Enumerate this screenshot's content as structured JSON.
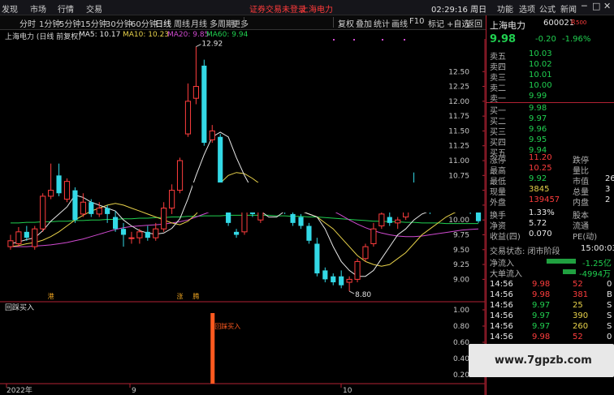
{
  "menubar": {
    "items": [
      "发现",
      "市场",
      "行情",
      "交易"
    ],
    "alert": "证券交易未登录",
    "stock": "上海电力",
    "time": "02:29:16 周日",
    "right_items": [
      "功能",
      "选项",
      "公式",
      "新闻"
    ],
    "window_controls": [
      "minimize-icon",
      "maximize-icon",
      "close-icon"
    ]
  },
  "toolbar": {
    "periods": [
      "分时",
      "1分钟",
      "5分钟",
      "15分钟",
      "30分钟",
      "60分钟",
      "日线",
      "周线",
      "月线",
      "多周期",
      "更多"
    ],
    "tools": [
      "复权",
      "叠加",
      "统计",
      "画线",
      "F10",
      "标记",
      "+自选",
      "返回"
    ]
  },
  "chart_header": {
    "title": "上海电力 (日线 前复权)",
    "ma5": "MA5: 10.17",
    "ma10": "MA10: 10.23",
    "ma20": "MA20: 9.85",
    "ma60": "MA60: 9.94"
  },
  "colors": {
    "up": "#ff3d3d",
    "down": "#33d9e6",
    "ma5": "#e8e8e8",
    "ma10": "#e8d24a",
    "ma20": "#d04ad0",
    "ma60": "#20d050",
    "bg": "#000000"
  },
  "chart_data": {
    "type": "candlestick",
    "y_ticks": [
      "12.50",
      "12.25",
      "12.00",
      "11.75",
      "11.50",
      "11.25",
      "11.00",
      "10.75",
      "10.50",
      "10.25",
      "10.00",
      "9.75",
      "9.50",
      "9.25",
      "9.00"
    ],
    "ylim": [
      8.65,
      13.05
    ],
    "annotations": [
      {
        "text": "12.92",
        "x_index": 23,
        "y": 12.92
      },
      {
        "text": "8.80",
        "x_index": 42,
        "y": 8.8
      }
    ],
    "signal_labels": [
      {
        "text": "港",
        "x_index": 5
      },
      {
        "text": "涨",
        "x_index": 21
      },
      {
        "text": "腾",
        "x_index": 23
      }
    ],
    "x_labels": [
      "2022年",
      "9",
      "10"
    ],
    "candles": [
      {
        "o": 9.55,
        "c": 9.65,
        "h": 9.75,
        "l": 9.5
      },
      {
        "o": 9.6,
        "c": 9.8,
        "h": 9.88,
        "l": 9.55
      },
      {
        "o": 9.8,
        "c": 9.7,
        "h": 9.9,
        "l": 9.65
      },
      {
        "o": 9.55,
        "c": 9.85,
        "h": 9.9,
        "l": 9.5
      },
      {
        "o": 9.85,
        "c": 10.4,
        "h": 10.45,
        "l": 9.8
      },
      {
        "o": 10.4,
        "c": 10.5,
        "h": 10.95,
        "l": 10.35
      },
      {
        "o": 10.75,
        "c": 10.45,
        "h": 10.95,
        "l": 10.4
      },
      {
        "o": 10.35,
        "c": 10.65,
        "h": 10.7,
        "l": 10.3
      },
      {
        "o": 10.5,
        "c": 10.0,
        "h": 10.55,
        "l": 9.95
      },
      {
        "o": 10.1,
        "c": 10.3,
        "h": 10.45,
        "l": 10.05
      },
      {
        "o": 10.3,
        "c": 10.1,
        "h": 10.35,
        "l": 10.05
      },
      {
        "o": 10.1,
        "c": 10.2,
        "h": 10.3,
        "l": 10.05
      },
      {
        "o": 10.2,
        "c": 10.1,
        "h": 10.25,
        "l": 9.95
      },
      {
        "o": 10.05,
        "c": 9.85,
        "h": 10.15,
        "l": 9.8
      },
      {
        "o": 9.85,
        "c": 9.75,
        "h": 9.95,
        "l": 9.55
      },
      {
        "o": 9.7,
        "c": 9.7,
        "h": 9.8,
        "l": 9.6
      },
      {
        "o": 9.7,
        "c": 9.8,
        "h": 9.85,
        "l": 9.6
      },
      {
        "o": 9.8,
        "c": 9.7,
        "h": 9.9,
        "l": 9.65
      },
      {
        "o": 9.7,
        "c": 9.85,
        "h": 9.95,
        "l": 9.65
      },
      {
        "o": 9.85,
        "c": 10.2,
        "h": 10.3,
        "l": 9.8
      },
      {
        "o": 10.2,
        "c": 10.5,
        "h": 10.6,
        "l": 10.1
      },
      {
        "o": 10.5,
        "c": 11.0,
        "h": 11.05,
        "l": 10.45
      },
      {
        "o": 11.45,
        "c": 12.0,
        "h": 12.3,
        "l": 11.4
      },
      {
        "o": 12.05,
        "c": 12.25,
        "h": 12.92,
        "l": 11.95
      },
      {
        "o": 12.6,
        "c": 11.3,
        "h": 12.7,
        "l": 11.25
      },
      {
        "o": 11.35,
        "c": 11.5,
        "h": 11.6,
        "l": 11.3
      },
      {
        "o": 11.4,
        "c": 10.2,
        "h": 11.45,
        "l": 10.15
      },
      {
        "o": 10.3,
        "c": 9.95,
        "h": 10.4,
        "l": 9.9
      },
      {
        "o": 9.8,
        "c": 9.75,
        "h": 9.85,
        "l": 9.7
      },
      {
        "o": 9.8,
        "c": 10.3,
        "h": 10.5,
        "l": 9.75
      },
      {
        "o": 10.4,
        "c": 10.1,
        "h": 10.5,
        "l": 10.05
      },
      {
        "o": 10.0,
        "c": 10.3,
        "h": 10.4,
        "l": 9.95
      },
      {
        "o": 10.3,
        "c": 10.25,
        "h": 10.45,
        "l": 10.2
      },
      {
        "o": 10.2,
        "c": 10.3,
        "h": 10.35,
        "l": 10.15
      },
      {
        "o": 10.3,
        "c": 10.15,
        "h": 10.4,
        "l": 10.1
      },
      {
        "o": 10.1,
        "c": 9.95,
        "h": 10.2,
        "l": 9.9
      },
      {
        "o": 10.05,
        "c": 9.9,
        "h": 10.1,
        "l": 9.85
      },
      {
        "o": 9.9,
        "c": 9.65,
        "h": 9.95,
        "l": 9.6
      },
      {
        "o": 9.6,
        "c": 9.1,
        "h": 9.7,
        "l": 9.05
      },
      {
        "o": 9.15,
        "c": 9.0,
        "h": 9.2,
        "l": 8.95
      },
      {
        "o": 9.05,
        "c": 8.95,
        "h": 9.1,
        "l": 8.9
      },
      {
        "o": 9.05,
        "c": 8.9,
        "h": 9.15,
        "l": 8.85
      },
      {
        "o": 8.95,
        "c": 9.0,
        "h": 9.05,
        "l": 8.8
      },
      {
        "o": 9.0,
        "c": 9.3,
        "h": 9.35,
        "l": 8.95
      },
      {
        "o": 9.35,
        "c": 9.55,
        "h": 9.6,
        "l": 9.3
      },
      {
        "o": 9.6,
        "c": 9.85,
        "h": 9.95,
        "l": 9.55
      },
      {
        "o": 9.9,
        "c": 10.1,
        "h": 10.15,
        "l": 9.85
      },
      {
        "o": 10.05,
        "c": 9.95,
        "h": 10.15,
        "l": 9.9
      },
      {
        "o": 9.95,
        "c": 10.0,
        "h": 10.05,
        "l": 9.85
      },
      {
        "o": 10.05,
        "c": 10.2,
        "h": 10.25,
        "l": 10.0
      },
      {
        "o": 10.4,
        "c": 10.25,
        "h": 10.8,
        "l": 10.2
      },
      {
        "o": 10.25,
        "c": 10.4,
        "h": 10.45,
        "l": 10.2
      },
      {
        "o": 10.45,
        "c": 10.2,
        "h": 10.5,
        "l": 10.1
      },
      {
        "o": 10.3,
        "c": 10.25,
        "h": 10.45,
        "l": 10.2
      },
      {
        "o": 10.25,
        "c": 10.3,
        "h": 10.35,
        "l": 10.2
      },
      {
        "o": 10.35,
        "c": 10.2,
        "h": 10.45,
        "l": 10.15
      },
      {
        "o": 10.2,
        "c": 10.3,
        "h": 10.6,
        "l": 10.15
      },
      {
        "o": 10.3,
        "c": 10.15,
        "h": 10.45,
        "l": 10.1
      },
      {
        "o": 10.15,
        "c": 9.98,
        "h": 10.2,
        "l": 9.95
      }
    ],
    "ma5": [
      9.6,
      9.63,
      9.67,
      9.7,
      9.82,
      9.98,
      10.1,
      10.22,
      10.42,
      10.38,
      10.3,
      10.25,
      10.2,
      10.15,
      10.0,
      9.9,
      9.82,
      9.78,
      9.76,
      9.78,
      9.86,
      10.02,
      10.36,
      10.75,
      11.1,
      11.4,
      11.48,
      11.4,
      11.05,
      10.75,
      10.5,
      10.15,
      10.05,
      10.05,
      10.15,
      10.15,
      10.15,
      10.1,
      10.05,
      9.85,
      9.55,
      9.3,
      9.15,
      9.05,
      9.05,
      9.15,
      9.35,
      9.55,
      9.75,
      9.85,
      10.0,
      10.1,
      10.15,
      10.2,
      10.25,
      10.3,
      10.3,
      10.28,
      10.2
    ],
    "ma10": [
      9.55,
      9.57,
      9.6,
      9.62,
      9.66,
      9.72,
      9.8,
      9.9,
      10.0,
      10.08,
      10.15,
      10.2,
      10.25,
      10.28,
      10.25,
      10.2,
      10.15,
      10.1,
      10.05,
      10.0,
      9.95,
      9.92,
      9.98,
      10.1,
      10.28,
      10.45,
      10.62,
      10.75,
      10.8,
      10.78,
      10.7,
      10.6,
      10.5,
      10.4,
      10.3,
      10.22,
      10.15,
      10.1,
      10.05,
      9.95,
      9.85,
      9.7,
      9.55,
      9.4,
      9.3,
      9.25,
      9.22,
      9.25,
      9.35,
      9.45,
      9.6,
      9.75,
      9.85,
      9.95,
      10.05,
      10.12,
      10.18,
      10.22,
      10.23
    ],
    "ma20": [
      9.55,
      9.55,
      9.55,
      9.56,
      9.57,
      9.58,
      9.6,
      9.62,
      9.65,
      9.68,
      9.72,
      9.76,
      9.8,
      9.84,
      9.87,
      9.89,
      9.9,
      9.91,
      9.92,
      9.93,
      9.95,
      9.97,
      10.0,
      10.05,
      10.1,
      10.15,
      10.2,
      10.25,
      10.3,
      10.32,
      10.34,
      10.36,
      10.37,
      10.38,
      10.38,
      10.37,
      10.35,
      10.32,
      10.28,
      10.22,
      10.15,
      10.08,
      10.0,
      9.93,
      9.87,
      9.82,
      9.78,
      9.75,
      9.73,
      9.72,
      9.72,
      9.73,
      9.75,
      9.77,
      9.79,
      9.81,
      9.83,
      9.84,
      9.85
    ],
    "ma60": [
      9.95,
      9.95,
      9.96,
      9.96,
      9.97,
      9.97,
      9.98,
      9.98,
      9.99,
      9.99,
      10.0,
      10.0,
      10.01,
      10.01,
      10.02,
      10.02,
      10.03,
      10.03,
      10.04,
      10.04,
      10.05,
      10.05,
      10.06,
      10.06,
      10.07,
      10.07,
      10.07,
      10.08,
      10.08,
      10.08,
      10.08,
      10.08,
      10.08,
      10.07,
      10.07,
      10.06,
      10.06,
      10.05,
      10.05,
      10.04,
      10.03,
      10.02,
      10.01,
      10.0,
      9.99,
      9.98,
      9.98,
      9.97,
      9.97,
      9.96,
      9.96,
      9.95,
      9.95,
      9.95,
      9.94,
      9.94,
      9.94,
      9.94,
      9.94
    ]
  },
  "indicator": {
    "title": "回踩买入",
    "y_ticks": [
      "1.00",
      "0.80",
      "0.60",
      "0.40",
      "0.20"
    ],
    "signal_label": "回踩买入",
    "signal_x_index": 25,
    "signal_value": 1.0
  },
  "sidebar": {
    "stock_name": "上海电力",
    "stock_code": "600021",
    "tag": "R",
    "tag_num": "500",
    "price": "9.98",
    "change": "-0.20",
    "change_pct": "-1.96%",
    "asks": [
      {
        "label": "卖五",
        "price": "10.03",
        "vol": ""
      },
      {
        "label": "卖四",
        "price": "10.02",
        "vol": ""
      },
      {
        "label": "卖三",
        "price": "10.01",
        "vol": ""
      },
      {
        "label": "卖二",
        "price": "10.00",
        "vol": ""
      },
      {
        "label": "卖一",
        "price": "9.99",
        "vol": ""
      }
    ],
    "bids": [
      {
        "label": "买一",
        "price": "9.98",
        "vol": ""
      },
      {
        "label": "买二",
        "price": "9.97",
        "vol": ""
      },
      {
        "label": "买三",
        "price": "9.96",
        "vol": ""
      },
      {
        "label": "买四",
        "price": "9.95",
        "vol": ""
      },
      {
        "label": "买五",
        "price": "9.94",
        "vol": ""
      }
    ],
    "stats": [
      {
        "k": "涨停",
        "v": "11.20",
        "k2": "跌停",
        "v2": ""
      },
      {
        "k": "最高",
        "v": "10.25",
        "k2": "量比",
        "v2": ""
      },
      {
        "k": "最低",
        "v": "9.92",
        "k2": "市值",
        "v2": "26"
      },
      {
        "k": "现量",
        "v": "3845",
        "k2": "总量",
        "v2": "3"
      },
      {
        "k": "外盘",
        "v": "139457",
        "k2": "内盘",
        "v2": "2"
      },
      {
        "k": "换手",
        "v": "1.33%",
        "k2": "股本",
        "v2": ""
      },
      {
        "k": "净资",
        "v": "5.72",
        "k2": "流通",
        "v2": ""
      },
      {
        "k": "收益(四)",
        "v": "0.070",
        "k2": "PE(动)",
        "v2": ""
      }
    ],
    "trade_status": "交易状态: 闭市阶段",
    "trade_time": "15:00:03",
    "net_inflow_label": "净流入",
    "net_inflow": "-1.25亿",
    "big_inflow_label": "大单流入",
    "big_inflow": "-4994万",
    "ticks": [
      {
        "t": "14:56",
        "p": "9.98",
        "v": "52",
        "s": "0"
      },
      {
        "t": "14:56",
        "p": "9.98",
        "v": "381",
        "s": "B"
      },
      {
        "t": "14:56",
        "p": "9.97",
        "v": "25",
        "s": "S"
      },
      {
        "t": "14:56",
        "p": "9.97",
        "v": "390",
        "s": "S"
      },
      {
        "t": "14:56",
        "p": "9.97",
        "v": "260",
        "s": "S"
      },
      {
        "t": "14:56",
        "p": "9.98",
        "v": "52",
        "s": "0"
      }
    ]
  },
  "watermark": "www.7gpzb.com"
}
